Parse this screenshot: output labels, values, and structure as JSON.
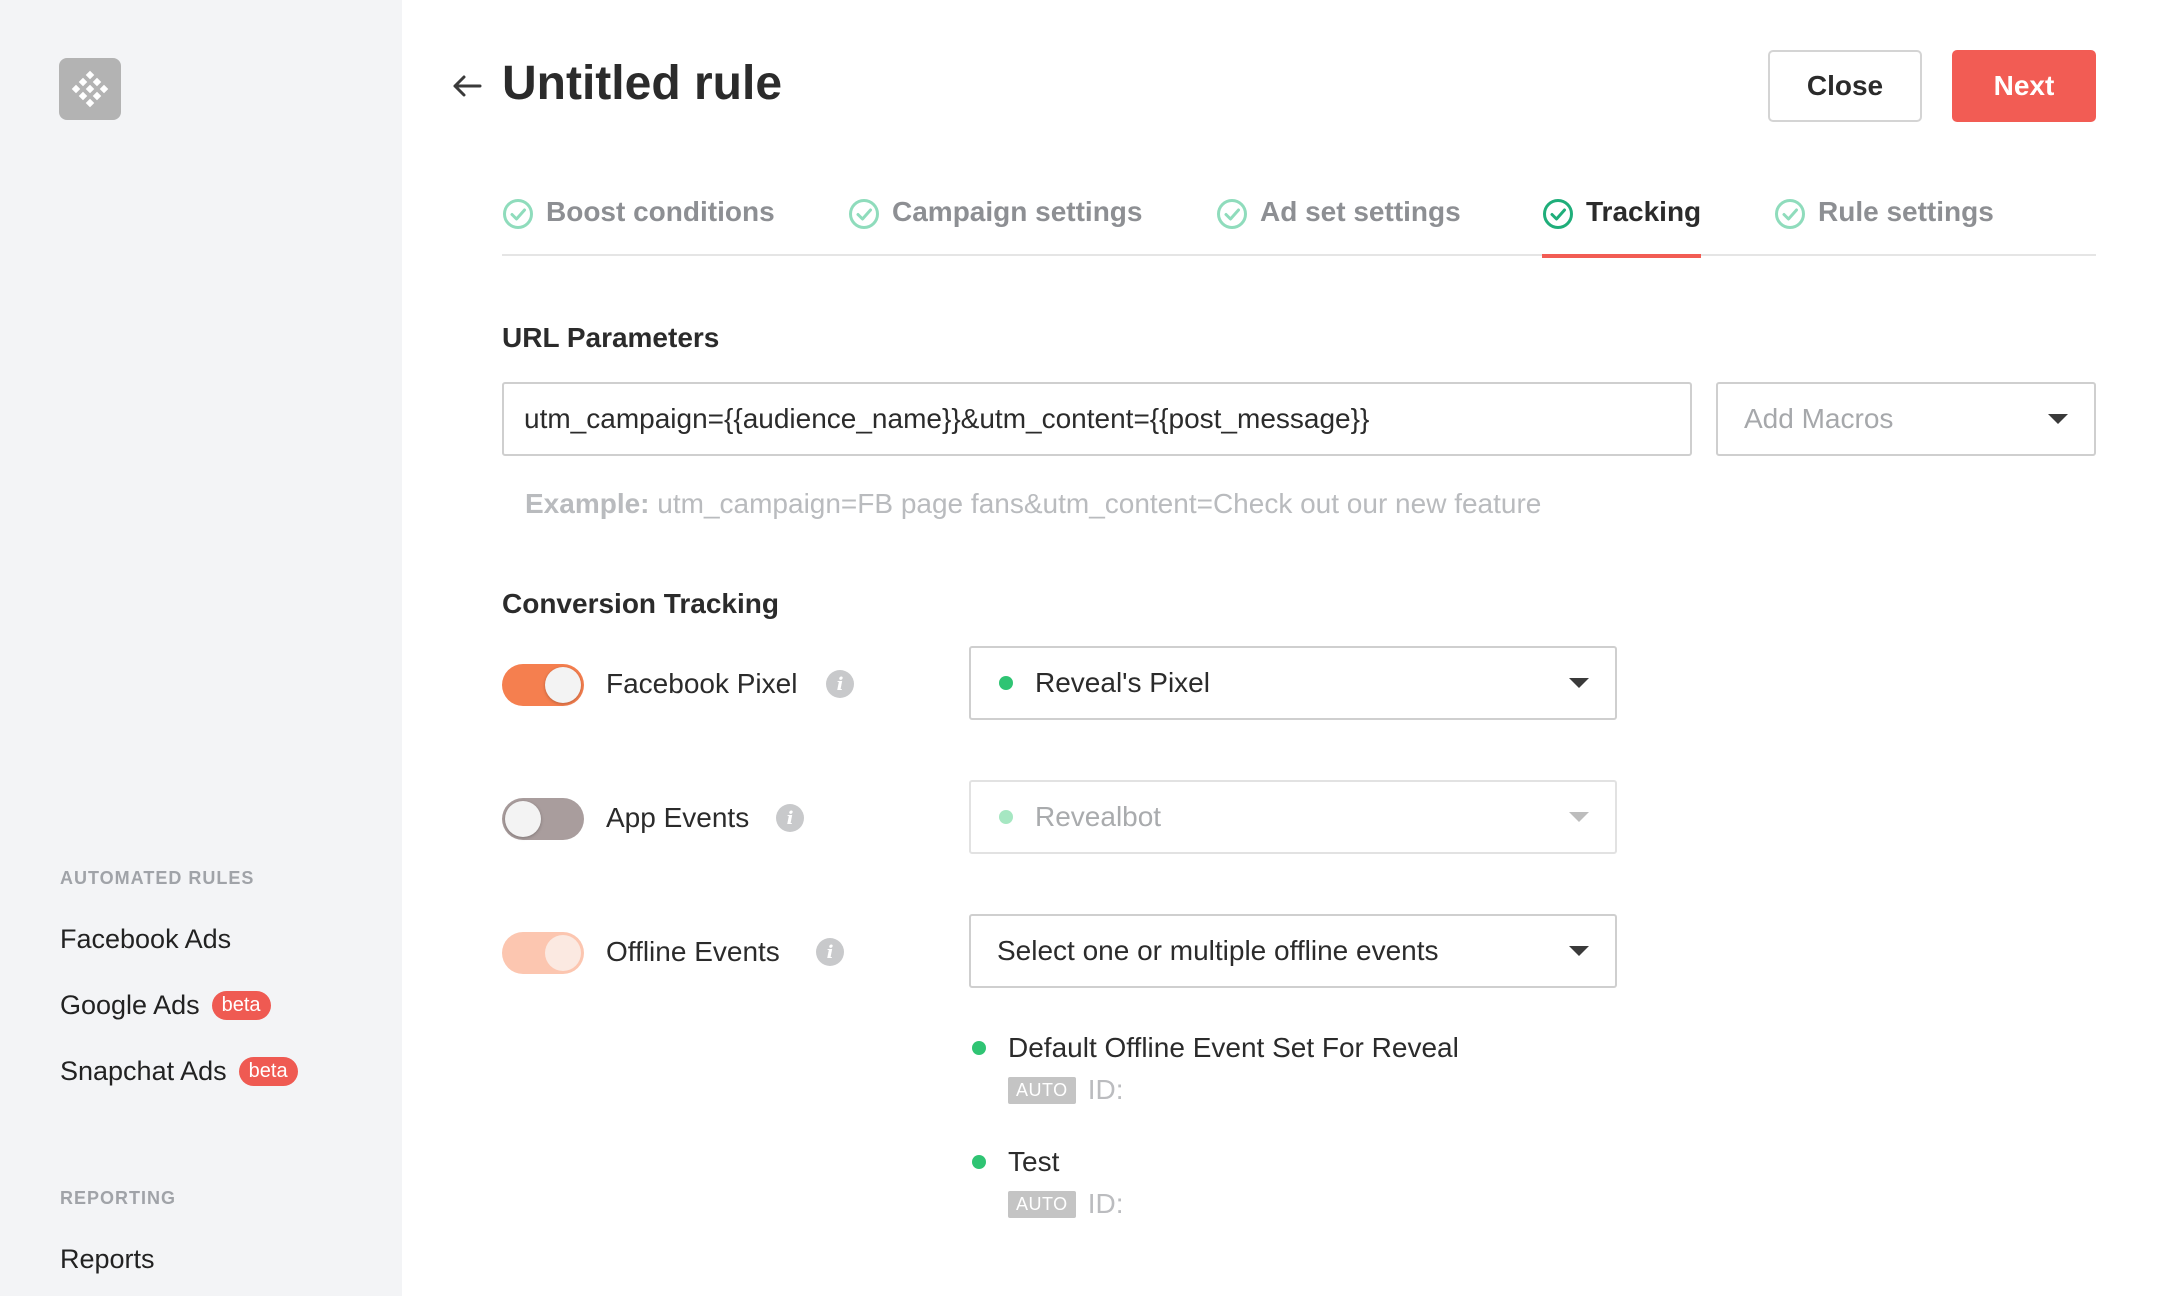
{
  "sidebar": {
    "logo_icon": "revealbot-logo",
    "sections": [
      {
        "title": "AUTOMATED RULES"
      },
      {
        "title": "REPORTING"
      }
    ],
    "items": [
      {
        "label": "Facebook Ads",
        "badge": ""
      },
      {
        "label": "Google Ads",
        "badge": "beta"
      },
      {
        "label": "Snapchat Ads",
        "badge": "beta"
      },
      {
        "label": "Reports",
        "badge": ""
      }
    ]
  },
  "header": {
    "back_icon": "arrow-left-icon",
    "title": "Untitled rule",
    "close_label": "Close",
    "next_label": "Next"
  },
  "tabs": [
    {
      "label": "Boost conditions",
      "active": false
    },
    {
      "label": "Campaign settings",
      "active": false
    },
    {
      "label": "Ad set settings",
      "active": false
    },
    {
      "label": "Tracking",
      "active": true
    },
    {
      "label": "Rule settings",
      "active": false
    }
  ],
  "url_parameters": {
    "label": "URL Parameters",
    "value": "utm_campaign={{audience_name}}&utm_content={{post_message}}",
    "macros_placeholder": "Add Macros",
    "example_label": "Example:",
    "example_text": " utm_campaign=FB page fans&utm_content=Check out our new feature"
  },
  "conversion_tracking": {
    "label": "Conversion Tracking",
    "rows": [
      {
        "label": "Facebook Pixel",
        "toggle": "on",
        "select_value": "Reveal's Pixel",
        "has_dot": true
      },
      {
        "label": "App Events",
        "toggle": "off",
        "select_value": "Revealbot",
        "has_dot": true
      },
      {
        "label": "Offline Events",
        "toggle": "disabled-on",
        "select_value": "Select one or multiple offline events",
        "has_dot": false
      }
    ],
    "offline_event_sets": [
      {
        "name": "Default Offline Event Set For Reveal",
        "tag": "AUTO",
        "id_label": "ID:"
      },
      {
        "name": "Test",
        "tag": "AUTO",
        "id_label": "ID:"
      }
    ]
  },
  "colors": {
    "accent": "#f25c54",
    "toggle_on": "#f57f4f",
    "tab_check": "#3ec58f",
    "status_green": "#2fc473"
  }
}
